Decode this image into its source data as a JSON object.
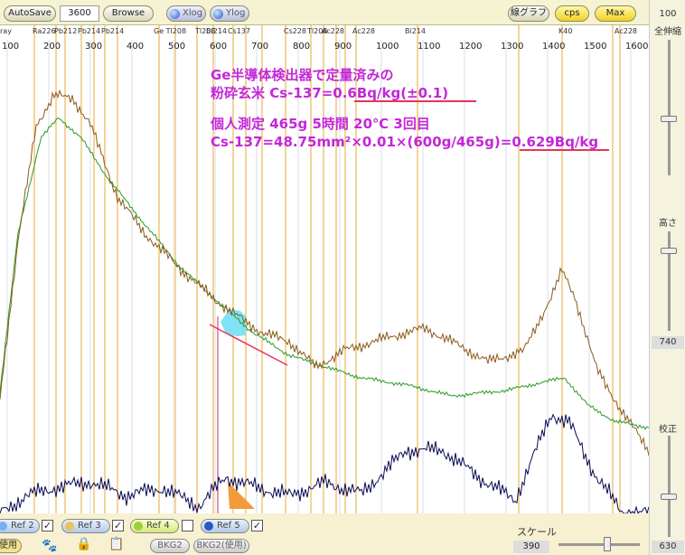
{
  "toolbar": {
    "autosave": "AutoSave",
    "time_value": "3600",
    "browse": "Browse",
    "xlog": "Xlog",
    "ylog": "Ylog",
    "linegraph": "線グラフ",
    "cps": "cps",
    "max": "Max"
  },
  "axis": {
    "x_ticks": [
      "100",
      "200",
      "300",
      "400",
      "500",
      "600",
      "700",
      "800",
      "900",
      "1000",
      "1100",
      "1200",
      "1300",
      "1400",
      "1500",
      "1600"
    ]
  },
  "nuclide_labels": [
    "ray",
    "Ra226",
    "Pb212",
    "Pb214",
    "Pb214",
    "Ge Tl208",
    "Tl208",
    "Bi214",
    "Cs137",
    "Cs228",
    "Tl208",
    "Ac228",
    "Ac228",
    "Bi214",
    "K40",
    "Ac228"
  ],
  "annotation": {
    "line1": "Ge半導体検出器で定量済みの",
    "line2_prefix": "粉砕玄米 Cs-137=",
    "line2_value": "0.6Bq/kg(±0.1)",
    "line3": "個人測定 465g 5時間 20℃ 3回目",
    "line4_prefix": "Cs-137=48.75mm²×0.01×(600g/465g)=",
    "line4_value": "0.629Bq/kg"
  },
  "right_panel": {
    "top_value": "100",
    "zenshinshuku": "全伸縮",
    "takasa": "高さ",
    "takasa_value": "740",
    "kousei": "校正",
    "kousei_value": "630"
  },
  "bottom": {
    "refs": [
      "Ref 2",
      "Ref 3",
      "Ref 4",
      "Ref 5"
    ],
    "use_label": "使用",
    "bkg2": "BKG2",
    "bkg2_use": "BKG2(使用)",
    "scale_label": "スケール",
    "scale_value": "390"
  },
  "colors": {
    "spectrum": "#8b5a1a",
    "reference": "#2a9a2a",
    "difference": "#0b0b55",
    "marker": "#e8a830",
    "annotation": "#c327d8",
    "cs_peak_fill": "#7fe3f5",
    "ref5_fill": "#f39a3a"
  }
}
